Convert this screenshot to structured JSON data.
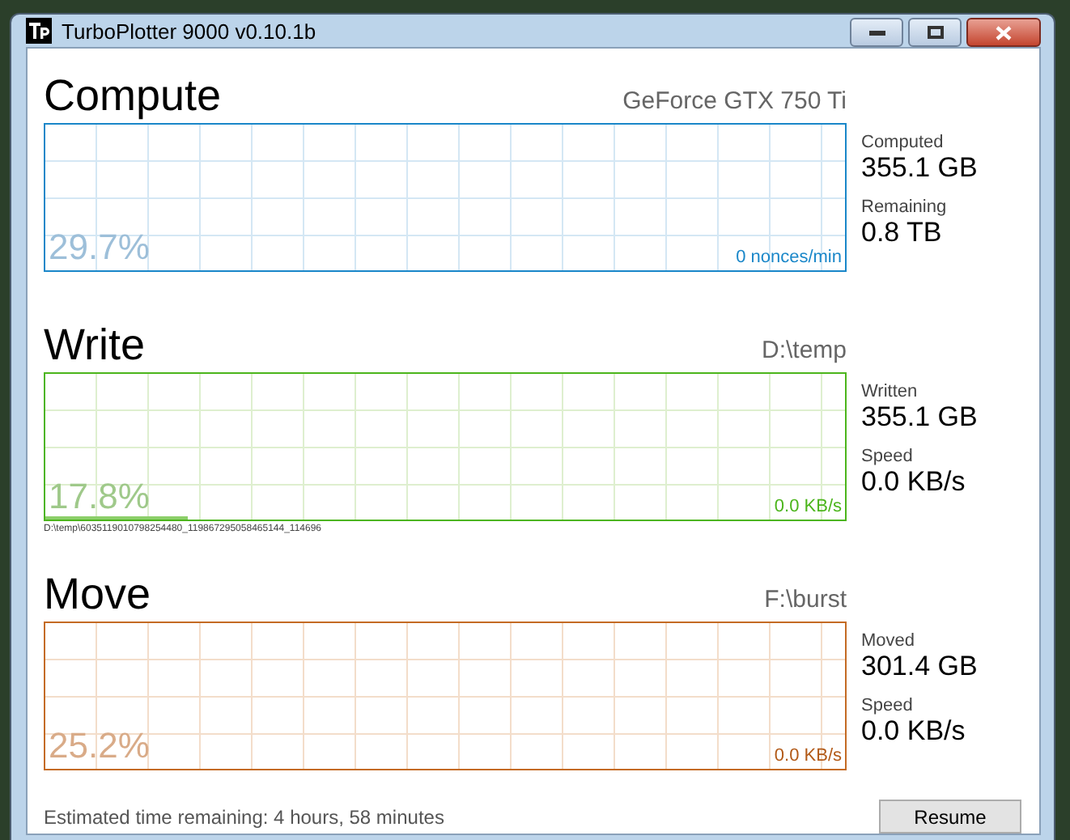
{
  "window": {
    "title": "TurboPlotter 9000 v0.10.1b"
  },
  "sections": [
    {
      "kind": "compute",
      "title": "Compute",
      "subtitle": "GeForce GTX 750 Ti",
      "percent": "29.7%",
      "rate": "0 nonces/min",
      "stats": [
        {
          "label": "Computed",
          "value": "355.1 GB"
        },
        {
          "label": "Remaining",
          "value": "0.8 TB"
        }
      ]
    },
    {
      "kind": "write",
      "title": "Write",
      "subtitle": "D:\\temp",
      "percent": "17.8%",
      "rate": "0.0 KB/s",
      "level": 0.178,
      "path": "D:\\temp\\6035119010798254480_119867295058465144_114696",
      "stats": [
        {
          "label": "Written",
          "value": "355.1 GB"
        },
        {
          "label": "Speed",
          "value": "0.0 KB/s"
        }
      ]
    },
    {
      "kind": "move",
      "title": "Move",
      "subtitle": "F:\\burst",
      "percent": "25.2%",
      "rate": "0.0 KB/s",
      "stats": [
        {
          "label": "Moved",
          "value": "301.4 GB"
        },
        {
          "label": "Speed",
          "value": "0.0 KB/s"
        }
      ]
    }
  ],
  "status": "Estimated time remaining: 4 hours, 58 minutes",
  "button": "Resume"
}
